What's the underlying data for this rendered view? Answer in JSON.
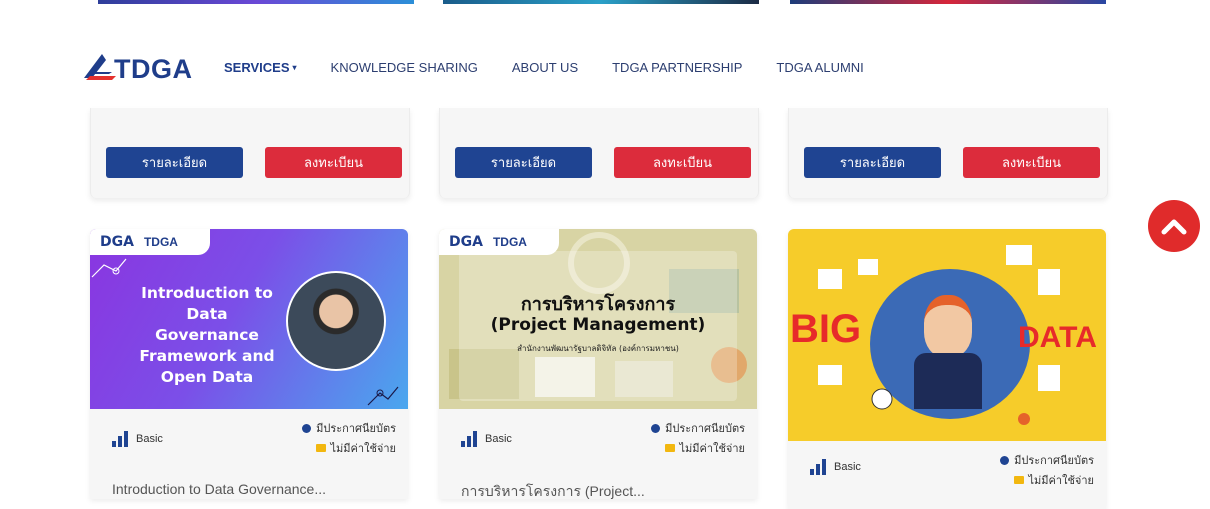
{
  "nav": {
    "logo_text": "TDGA",
    "items": [
      {
        "label": "SERVICES",
        "caret": "▾"
      },
      {
        "label": "KNOWLEDGE SHARING"
      },
      {
        "label": "ABOUT US"
      },
      {
        "label": "TDGA PARTNERSHIP"
      },
      {
        "label": "TDGA ALUMNI"
      }
    ]
  },
  "top_cards": [
    {
      "detail_label": "รายละเอียด",
      "register_label": "ลงทะเบียน"
    },
    {
      "detail_label": "รายละเอียด",
      "register_label": "ลงทะเบียน"
    },
    {
      "detail_label": "รายละเอียด",
      "register_label": "ลงทะเบียน"
    }
  ],
  "courses": [
    {
      "thumb": {
        "brand_dga": "DGA",
        "brand_tdga": "TDGA",
        "heading": "Introduction to Data Governance Framework and Open Data"
      },
      "level": "Basic",
      "certificate": "มีประกาศนียบัตร",
      "price": "ไม่มีค่าใช้จ่าย",
      "title_peek": "Introduction to Data Governance..."
    },
    {
      "thumb": {
        "brand_dga": "DGA",
        "brand_tdga": "TDGA",
        "line1": "การบริหารโครงการ",
        "line2": "(Project Management)",
        "line3": "สำนักงานพัฒนารัฐบาลดิจิทัล (องค์การมหาชน)"
      },
      "level": "Basic",
      "certificate": "มีประกาศนียบัตร",
      "price": "ไม่มีค่าใช้จ่าย",
      "title_peek": "การบริหารโครงการ (Project..."
    },
    {
      "thumb": {
        "word1": "BIG",
        "word2": "DATA"
      },
      "level": "Basic",
      "certificate": "มีประกาศนียบัตร",
      "price": "ไม่มีค่าใช้จ่าย"
    }
  ],
  "colors": {
    "brand_blue": "#1f4492",
    "brand_red": "#dc2c3c",
    "scroll_top": "#e02b2b"
  },
  "icons": [
    "chevron-up-icon",
    "level-bars-icon",
    "certificate-dot-icon",
    "free-tag-icon"
  ]
}
